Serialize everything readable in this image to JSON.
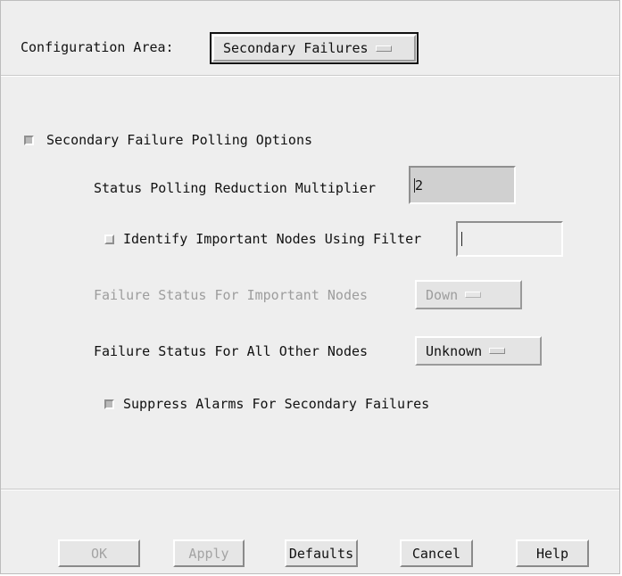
{
  "header": {
    "config_area_label": "Configuration Area:",
    "config_area_value": "Secondary Failures"
  },
  "polling": {
    "section_label": "Secondary Failure Polling Options",
    "section_enabled": true,
    "multiplier_label": "Status Polling Reduction Multiplier",
    "multiplier_value": "2",
    "identify_label": "Identify Important Nodes Using Filter",
    "identify_checked": false,
    "filter_value": "",
    "important_status_label": "Failure Status For Important Nodes",
    "important_status_value": "Down",
    "other_status_label": "Failure Status For All Other Nodes",
    "other_status_value": "Unknown",
    "suppress_label": "Suppress Alarms For Secondary Failures",
    "suppress_checked": true
  },
  "buttons": {
    "ok": "OK",
    "apply": "Apply",
    "defaults": "Defaults",
    "cancel": "Cancel",
    "help": "Help"
  }
}
